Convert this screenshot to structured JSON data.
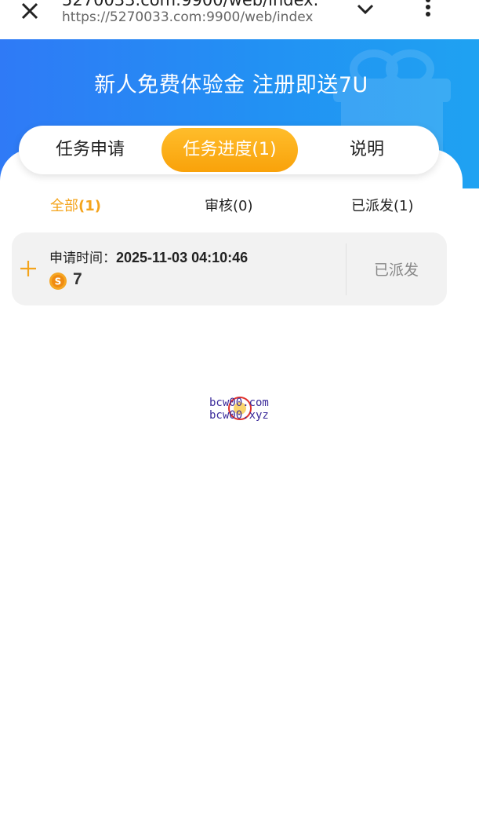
{
  "browser": {
    "url_title": "5270033.com:9900/web/index.",
    "url": "https://5270033.com:9900/web/index"
  },
  "banner": {
    "title": "新人免费体验金 注册即送7U"
  },
  "tabs": [
    {
      "label": "任务申请",
      "active": false
    },
    {
      "label": "任务进度(1)",
      "active": true
    },
    {
      "label": "说明",
      "active": false
    }
  ],
  "filters": {
    "all_label": "全部",
    "all_count": "(1)",
    "review": "审核(0)",
    "sent": "已派发(1)"
  },
  "records": [
    {
      "time_label": "申请时间：",
      "time_value": "2025-11-03 04:10:46",
      "amount": "7",
      "status": "已派发"
    }
  ],
  "watermark": {
    "line1": "bcw00.com",
    "line2": "bcw00.xyz"
  },
  "colors": {
    "banner_blue": "#2291f3",
    "accent_orange": "#f9a20a",
    "coin": "#f5a623"
  }
}
